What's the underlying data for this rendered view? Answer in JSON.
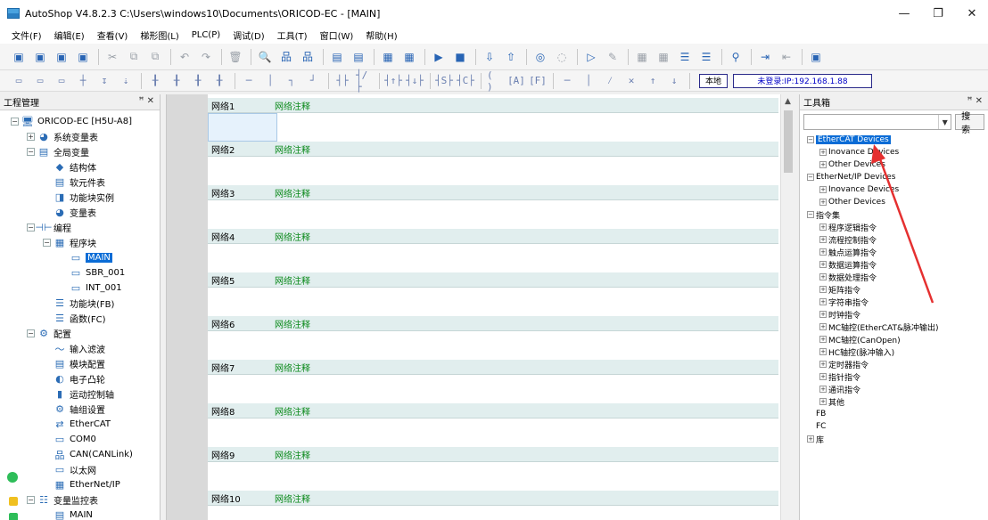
{
  "window": {
    "title": "AutoShop V4.8.2.3  C:\\Users\\windows10\\Documents\\ORICOD-EC - [MAIN]",
    "minimize": "—",
    "restore": "❐",
    "close": "✕"
  },
  "menu": [
    "文件(F)",
    "编辑(E)",
    "查看(V)",
    "梯形图(L)",
    "PLC(P)",
    "调试(D)",
    "工具(T)",
    "窗口(W)",
    "帮助(H)"
  ],
  "toolbar": {
    "local_label": "本地",
    "login_label": "未登录:IP:192.168.1.88"
  },
  "left_panel": {
    "title": "工程管理",
    "controls": "ꟸ ✕",
    "tree": [
      {
        "label": "ORICOD-EC [H5U-A8]",
        "level": 0,
        "exp": "−",
        "icon": "computer-icon"
      },
      {
        "label": "系统变量表",
        "level": 1,
        "exp": "+",
        "icon": "variable-icon"
      },
      {
        "label": "全局变量",
        "level": 1,
        "exp": "−",
        "icon": "table-icon"
      },
      {
        "label": "结构体",
        "level": 2,
        "exp": "",
        "icon": "struct-icon"
      },
      {
        "label": "软元件表",
        "level": 2,
        "exp": "",
        "icon": "list-icon"
      },
      {
        "label": "功能块实例",
        "level": 2,
        "exp": "",
        "icon": "block-icon"
      },
      {
        "label": "变量表",
        "level": 2,
        "exp": "",
        "icon": "variable-icon"
      },
      {
        "label": "编程",
        "level": 1,
        "exp": "−",
        "icon": "program-icon"
      },
      {
        "label": "程序块",
        "level": 2,
        "exp": "−",
        "icon": "grid-icon"
      },
      {
        "label": "MAIN",
        "level": 3,
        "exp": "",
        "icon": "main-file-icon",
        "selected": true
      },
      {
        "label": "SBR_001",
        "level": 3,
        "exp": "",
        "icon": "sbr-file-icon"
      },
      {
        "label": "INT_001",
        "level": 3,
        "exp": "",
        "icon": "int-file-icon"
      },
      {
        "label": "功能块(FB)",
        "level": 2,
        "exp": "",
        "icon": "fb-icon"
      },
      {
        "label": "函数(FC)",
        "level": 2,
        "exp": "",
        "icon": "fc-icon"
      },
      {
        "label": "配置",
        "level": 1,
        "exp": "−",
        "icon": "config-icon"
      },
      {
        "label": "输入滤波",
        "level": 2,
        "exp": "",
        "icon": "filter-icon"
      },
      {
        "label": "模块配置",
        "level": 2,
        "exp": "",
        "icon": "module-icon"
      },
      {
        "label": "电子凸轮",
        "level": 2,
        "exp": "",
        "icon": "cam-icon"
      },
      {
        "label": "运动控制轴",
        "level": 2,
        "exp": "",
        "icon": "axis-icon"
      },
      {
        "label": "轴组设置",
        "level": 2,
        "exp": "",
        "icon": "gear-icon"
      },
      {
        "label": "EtherCAT",
        "level": 2,
        "exp": "",
        "icon": "ethercat-icon"
      },
      {
        "label": "COM0",
        "level": 2,
        "exp": "",
        "icon": "com-port-icon"
      },
      {
        "label": "CAN(CANLink)",
        "level": 2,
        "exp": "",
        "icon": "can-icon"
      },
      {
        "label": "以太网",
        "level": 2,
        "exp": "",
        "icon": "ethernet-icon"
      },
      {
        "label": "EtherNet/IP",
        "level": 2,
        "exp": "",
        "icon": "ethernet-ip-icon"
      },
      {
        "label": "变量监控表",
        "level": 1,
        "exp": "−",
        "icon": "monitor-icon"
      },
      {
        "label": "MAIN",
        "level": 2,
        "exp": "",
        "icon": "table-icon"
      }
    ]
  },
  "networks": [
    {
      "num": "网络1",
      "comment": "网络注释"
    },
    {
      "num": "网络2",
      "comment": "网络注释"
    },
    {
      "num": "网络3",
      "comment": "网络注释"
    },
    {
      "num": "网络4",
      "comment": "网络注释"
    },
    {
      "num": "网络5",
      "comment": "网络注释"
    },
    {
      "num": "网络6",
      "comment": "网络注释"
    },
    {
      "num": "网络7",
      "comment": "网络注释"
    },
    {
      "num": "网络8",
      "comment": "网络注释"
    },
    {
      "num": "网络9",
      "comment": "网络注释"
    },
    {
      "num": "网络10",
      "comment": "网络注释"
    }
  ],
  "right_panel": {
    "title": "工具箱",
    "controls": "ꟸ ✕",
    "search_button": "搜索",
    "tree": [
      {
        "label": "EtherCAT Devices",
        "level": 0,
        "exp": "−",
        "selected": true
      },
      {
        "label": "Inovance Devices",
        "level": 1,
        "exp": "+"
      },
      {
        "label": "Other Devices",
        "level": 1,
        "exp": "+"
      },
      {
        "label": "EtherNet/IP Devices",
        "level": 0,
        "exp": "−"
      },
      {
        "label": "Inovance Devices",
        "level": 1,
        "exp": "+"
      },
      {
        "label": "Other Devices",
        "level": 1,
        "exp": "+"
      },
      {
        "label": "指令集",
        "level": 0,
        "exp": "−"
      },
      {
        "label": "程序逻辑指令",
        "level": 1,
        "exp": "+"
      },
      {
        "label": "流程控制指令",
        "level": 1,
        "exp": "+"
      },
      {
        "label": "触点运算指令",
        "level": 1,
        "exp": "+"
      },
      {
        "label": "数据运算指令",
        "level": 1,
        "exp": "+"
      },
      {
        "label": "数据处理指令",
        "level": 1,
        "exp": "+"
      },
      {
        "label": "矩阵指令",
        "level": 1,
        "exp": "+"
      },
      {
        "label": "字符串指令",
        "level": 1,
        "exp": "+"
      },
      {
        "label": "时钟指令",
        "level": 1,
        "exp": "+"
      },
      {
        "label": "MC轴控(EtherCAT&脉冲输出)",
        "level": 1,
        "exp": "+"
      },
      {
        "label": "MC轴控(CanOpen)",
        "level": 1,
        "exp": "+"
      },
      {
        "label": "HC轴控(脉冲输入)",
        "level": 1,
        "exp": "+"
      },
      {
        "label": "定时器指令",
        "level": 1,
        "exp": "+"
      },
      {
        "label": "指针指令",
        "level": 1,
        "exp": "+"
      },
      {
        "label": "通讯指令",
        "level": 1,
        "exp": "+"
      },
      {
        "label": "其他",
        "level": 1,
        "exp": "+"
      },
      {
        "label": "FB",
        "level": 0,
        "exp": ""
      },
      {
        "label": "FC",
        "level": 0,
        "exp": ""
      },
      {
        "label": "库",
        "level": 0,
        "exp": "+"
      }
    ]
  },
  "colors": {
    "selection": "#0a6cd6",
    "comment_green": "#0c8a1c",
    "annotation_arrow": "#e53030"
  }
}
